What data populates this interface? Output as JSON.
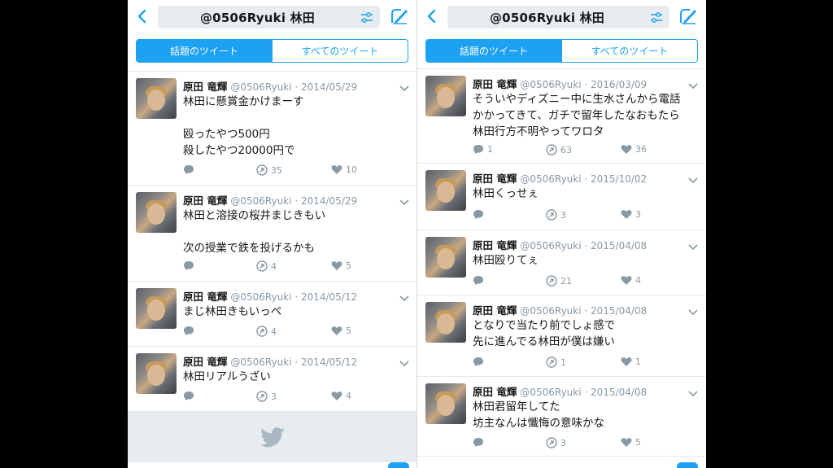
{
  "colors": {
    "accent": "#1da1f2",
    "muted": "#8899a6",
    "background": "#000000"
  },
  "panels": [
    {
      "search_query": "@0506Ryuki  林田",
      "tabs": [
        "話題のツイート",
        "すべてのツイート"
      ],
      "active_tab": 0,
      "tweets": [
        {
          "name": "原田 竜輝",
          "meta": "@0506Ryuki · 2014/05/29",
          "text": "林田に懸賞金かけまーす\n\n殴ったやつ500円\n殺したやつ20000円で",
          "reply": "",
          "retweets": "35",
          "likes": "10"
        },
        {
          "name": "原田 竜輝",
          "meta": "@0506Ryuki · 2014/05/29",
          "text": "林田と溶接の桜井まじきもい\n\n次の授業で鉄を投げるかも",
          "reply": "",
          "retweets": "4",
          "likes": "5"
        },
        {
          "name": "原田 竜輝",
          "meta": "@0506Ryuki · 2014/05/12",
          "text": "まじ林田きもいっぺ",
          "reply": "",
          "retweets": "4",
          "likes": "5"
        },
        {
          "name": "原田 竜輝",
          "meta": "@0506Ryuki · 2014/05/12",
          "text": "林田リアルうざい",
          "reply": "",
          "retweets": "3",
          "likes": "4"
        }
      ]
    },
    {
      "search_query": "@0506Ryuki  林田",
      "tabs": [
        "話題のツイート",
        "すべてのツイート"
      ],
      "active_tab": 0,
      "tweets": [
        {
          "name": "原田 竜輝",
          "meta": "@0506Ryuki · 2016/03/09",
          "text": "そういやディズニー中に生水さんから電話\nかかってきて、ガチで留年したなおもたら\n林田行方不明やってワロタ",
          "reply": "1",
          "retweets": "63",
          "likes": "36"
        },
        {
          "name": "原田 竜輝",
          "meta": "@0506Ryuki · 2015/10/02",
          "text": "林田くっせぇ",
          "reply": "",
          "retweets": "3",
          "likes": "3"
        },
        {
          "name": "原田 竜輝",
          "meta": "@0506Ryuki · 2015/04/08",
          "text": "林田殴りてぇ",
          "reply": "",
          "retweets": "21",
          "likes": "4"
        },
        {
          "name": "原田 竜輝",
          "meta": "@0506Ryuki · 2015/04/08",
          "text": "となりで当たり前でしょ感で\n先に進んでる林田が僕は嫌い",
          "reply": "",
          "retweets": "1",
          "likes": "1"
        },
        {
          "name": "原田 竜輝",
          "meta": "@0506Ryuki · 2015/04/08",
          "text": "林田君留年してた\n坊主なんは懺悔の意味かな",
          "reply": "",
          "retweets": "3",
          "likes": "5"
        }
      ]
    }
  ]
}
